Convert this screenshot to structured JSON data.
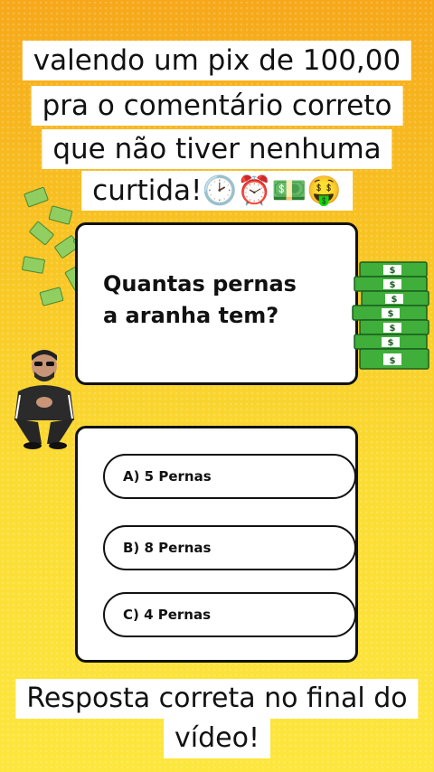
{
  "header": {
    "lines": [
      "valendo um pix de 100,00",
      "pra o comentário correto",
      "que não tiver nenhuma",
      "curtida!🕑⏰💵🤑"
    ]
  },
  "question": {
    "text_line1": "Quantas pernas",
    "text_line2": "a aranha tem?"
  },
  "options": [
    {
      "label": "A) 5 Pernas"
    },
    {
      "label": "B)  8 Pernas"
    },
    {
      "label": "C) 4 Pernas"
    }
  ],
  "footer": {
    "line1": "Resposta correta no final do",
    "line2": "vídeo!"
  },
  "money_stack": {
    "symbol": "$"
  },
  "colors": {
    "background_top": "#f6a81a",
    "background_bottom": "#fde63d",
    "bill_green": "#3fae3a"
  }
}
